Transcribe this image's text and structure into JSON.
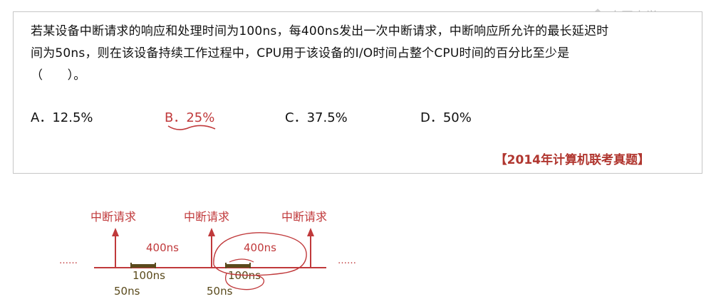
{
  "watermark": {
    "text": "中国大学MOOC"
  },
  "question": {
    "line1": "若某设备中断请求的响应和处理时间为100ns，每400ns发出一次中断请求，中断响应所允许的最长延迟时",
    "line2": "间为50ns，则在该设备持续工作过程中，CPU用于该设备的I/O时间占整个CPU时间的百分比至少是",
    "line3": "（　　）。"
  },
  "options": [
    {
      "label": "A．12.5%"
    },
    {
      "label": "B．25%"
    },
    {
      "label": "C．37.5%"
    },
    {
      "label": "D．50%"
    }
  ],
  "source": "【2014年计算机联考真题】",
  "diagram": {
    "interrupt_label": "中断请求",
    "period_label": "400ns",
    "service_label": "100ns",
    "delay_label": "50ns",
    "ellipsis": "……"
  },
  "colors": {
    "accent": "#c0393b",
    "service_bar": "#5a4a1c"
  }
}
